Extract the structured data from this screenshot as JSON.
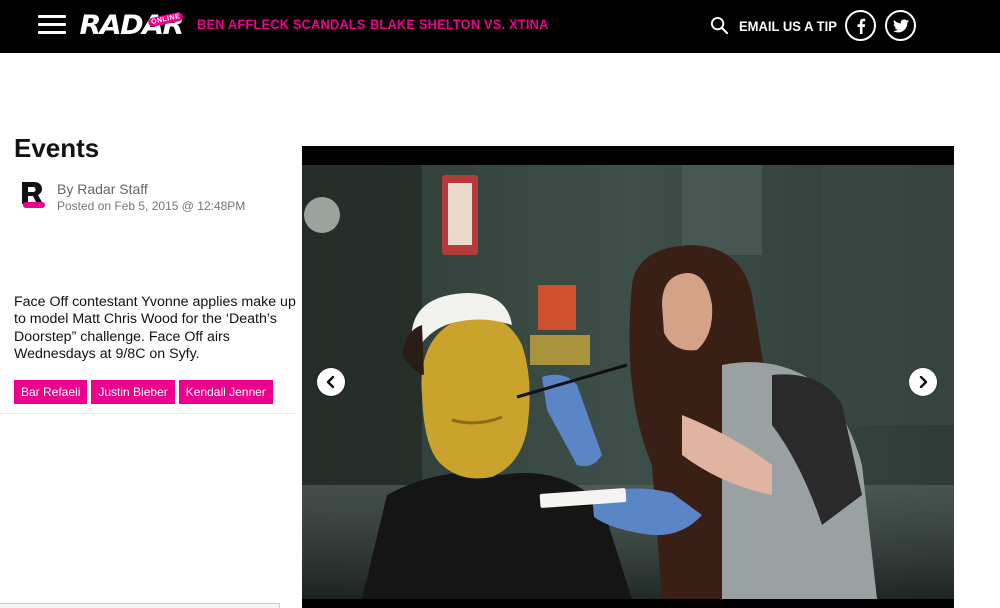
{
  "header": {
    "logo_text": "RADAR",
    "logo_badge": "ONLINE",
    "nav_links": [
      "BEN AFFLECK SCANDALS",
      "BLAKE SHELTON VS. XTINA"
    ],
    "tip_label": "EMAIL US A TIP",
    "icons": [
      "menu-icon",
      "search-icon",
      "facebook-icon",
      "twitter-icon"
    ]
  },
  "article": {
    "title_visible": "Events",
    "author": "By Radar Staff",
    "posted": "Posted on Feb 5, 2015 @ 12:48PM",
    "caption": "Face Off contestant Yvonne applies make up to model Matt Chris Wood for the ‘Death’s Doorstep” challenge. Face Off airs Wednesdays at 9/8C on Syfy.",
    "tags": [
      "Bar Refaeli",
      "Justin Bieber",
      "Kendall Jenner"
    ]
  },
  "colors": {
    "accent": "#ec008c",
    "nav_bg": "#000000"
  }
}
